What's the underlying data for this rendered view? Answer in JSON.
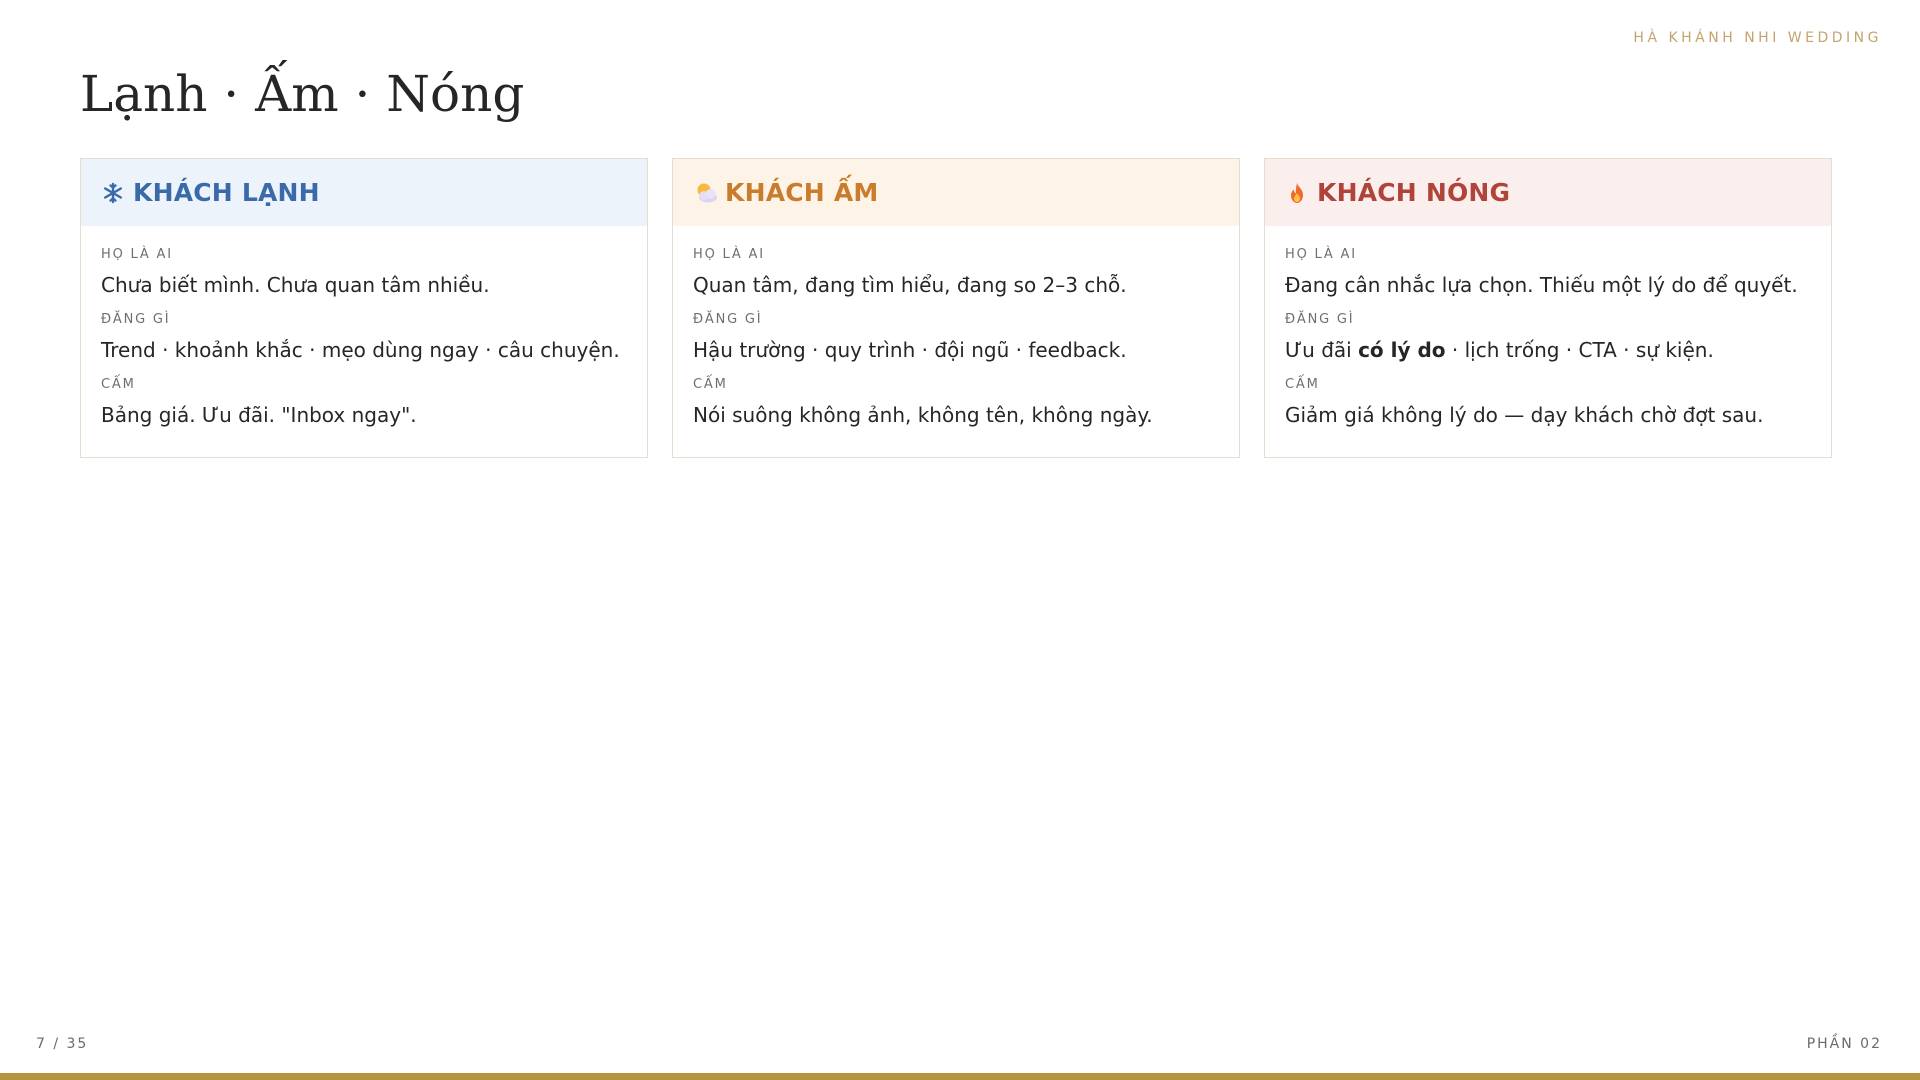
{
  "header": {
    "brand": "HÀ KHÁNH NHI WEDDING",
    "title": "Lạnh · Ấm · Nóng"
  },
  "cards": [
    {
      "icon": "snowflake-icon",
      "title": "KHÁCH LẠNH",
      "who_label": "HỌ LÀ AI",
      "who_text": "Chưa biết mình. Chưa quan tâm nhiều.",
      "post_label": "ĐĂNG GÌ",
      "post_text": "Trend · khoảnh khắc · mẹo dùng ngay · câu chuyện.",
      "ban_label": "CẤM",
      "ban_text": "Bảng giá. Ưu đãi. \"Inbox ngay\".",
      "accent": "#3a6aa8"
    },
    {
      "icon": "sun-behind-cloud-icon",
      "title": "KHÁCH ẤM",
      "who_label": "HỌ LÀ AI",
      "who_text": "Quan tâm, đang tìm hiểu, đang so 2–3 chỗ.",
      "post_label": "ĐĂNG GÌ",
      "post_text": "Hậu trường · quy trình · đội ngũ · feedback.",
      "ban_label": "CẤM",
      "ban_text": "Nói suông không ảnh, không tên, không ngày.",
      "accent": "#c97c2c"
    },
    {
      "icon": "fire-icon",
      "title": "KHÁCH NÓNG",
      "who_label": "HỌ LÀ AI",
      "who_text": "Đang cân nhắc lựa chọn. Thiếu một lý do để quyết.",
      "post_label": "ĐĂNG GÌ",
      "post_text_pre": "Ưu đãi ",
      "post_text_bold": "có lý do",
      "post_text_post": " · lịch trống · CTA · sự kiện.",
      "ban_label": "CẤM",
      "ban_text": "Giảm giá không lý do — dạy khách chờ đợt sau.",
      "accent": "#b0433a"
    }
  ],
  "footer": {
    "page": "7 / 35",
    "section": "PHẦN 02"
  },
  "colors": {
    "brand_gold": "#c4a46e",
    "bottom_bar": "#b3963f"
  }
}
